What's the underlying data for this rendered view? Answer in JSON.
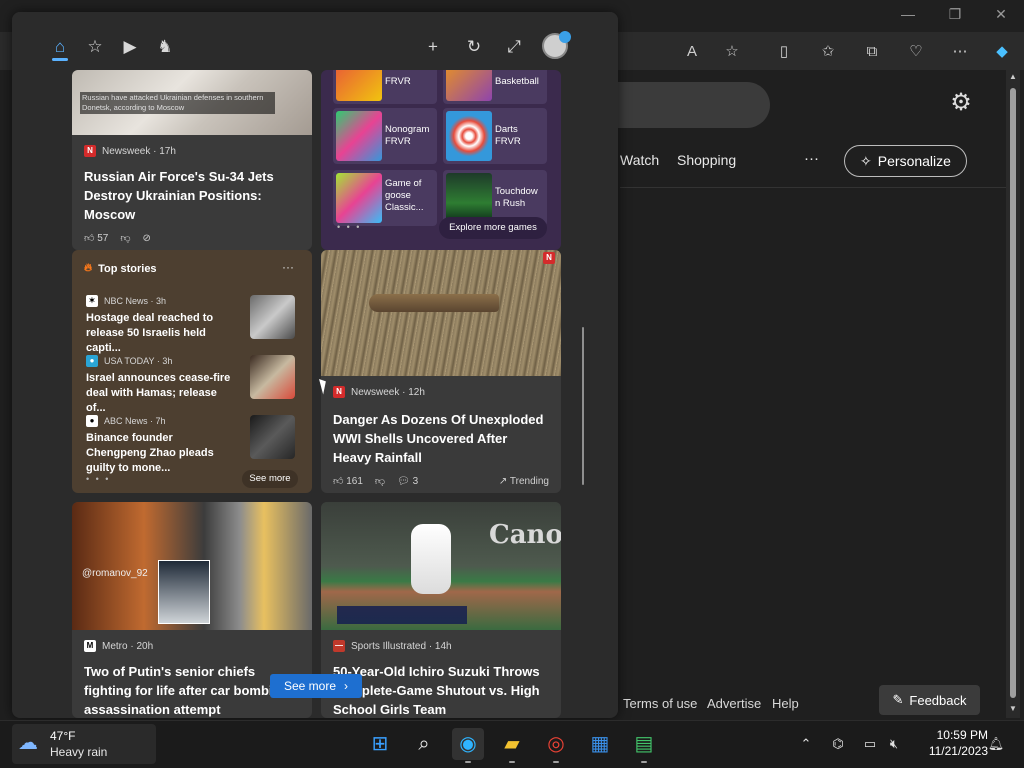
{
  "browser": {
    "window_controls": {
      "minimize": "—",
      "restore": "❐",
      "close": "✕"
    },
    "nav_links": [
      "Watch",
      "Shopping"
    ],
    "nav_more": "···",
    "personalize_label": "Personalize",
    "footer_links": [
      "Terms of use",
      "Advertise",
      "Help"
    ],
    "feedback_label": "Feedback"
  },
  "widgets": {
    "tabs": [
      "home-icon",
      "star-plus-icon",
      "play-icon",
      "chess-knight-icon"
    ],
    "actions": [
      "add-icon",
      "refresh-icon",
      "expand-icon"
    ],
    "cards": {
      "russia": {
        "image_caption": "Russian                 have attacked Ukrainian defenses in southern Donetsk, according to Moscow",
        "source": "Newsweek · 17h",
        "headline": "Russian Air Force's Su-34 Jets Destroy Ukrainian Positions: Moscow",
        "likes": "57"
      },
      "games": {
        "items": [
          {
            "name": "FRVR"
          },
          {
            "name": "Basketball"
          },
          {
            "name": "Nonogram FRVR"
          },
          {
            "name": "Darts FRVR"
          },
          {
            "name": "Game of goose Classic..."
          },
          {
            "name": "Touchdow n Rush"
          }
        ],
        "explore_label": "Explore more games",
        "dots": "• • •"
      },
      "top_stories": {
        "title": "Top stories",
        "more": "···",
        "items": [
          {
            "source": "NBC News · 3h",
            "title": "Hostage deal reached to release 50 Israelis held capti..."
          },
          {
            "source": "USA TODAY · 3h",
            "title": "Israel announces cease-fire deal with Hamas; release of..."
          },
          {
            "source": "ABC News · 7h",
            "title": "Binance founder Chengpeng Zhao pleads guilty to mone..."
          }
        ],
        "dots": "• • •",
        "see_more": "See more"
      },
      "danger": {
        "source": "Newsweek · 12h",
        "headline": "Danger As Dozens Of Unexploded WWI Shells Uncovered After Heavy Rainfall",
        "likes": "161",
        "comments": "3",
        "trending": "Trending"
      },
      "putin": {
        "image_tag": "@romanov_92",
        "source": "Metro · 20h",
        "headline": "Two of Putin's senior chiefs fighting for life after car bombing assassination attempt"
      },
      "ichiro": {
        "image_text": "Canon",
        "source": "Sports Illustrated · 14h",
        "headline": "50-Year-Old Ichiro Suzuki Throws Complete-Game Shutout vs. High School Girls Team"
      }
    },
    "see_more_button": "See more"
  },
  "taskbar": {
    "weather": {
      "temp": "47°F",
      "condition": "Heavy rain"
    },
    "clock": {
      "time": "10:59 PM",
      "date": "11/21/2023"
    }
  },
  "colors": {
    "accent": "#5bb2ff",
    "see_more_blue": "#1e6fd0",
    "panel_bg": "#2b2b2b",
    "games_card_bg": "#3b2a4d",
    "top_stories_bg": "#4d3f30"
  }
}
